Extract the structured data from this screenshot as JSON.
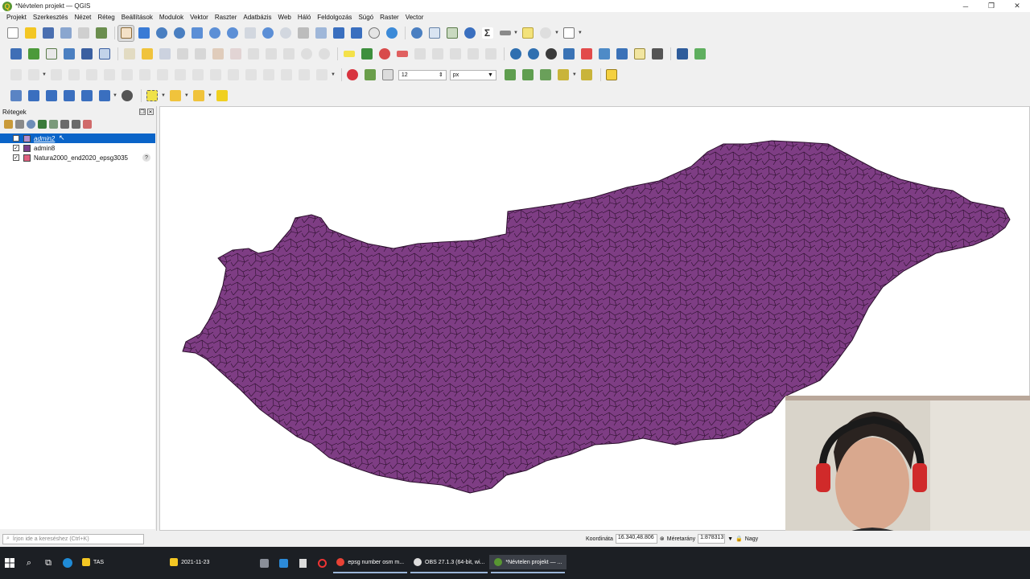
{
  "window": {
    "title": "*Névtelen projekt — QGIS",
    "logo": "Q",
    "minimize": "─",
    "maximize": "❐",
    "close": "✕"
  },
  "menu": [
    "Projekt",
    "Szerkesztés",
    "Nézet",
    "Réteg",
    "Beállítások",
    "Modulok",
    "Vektor",
    "Raszter",
    "Adatbázis",
    "Web",
    "Háló",
    "Feldolgozás",
    "Súgó",
    "Raster",
    "Vector"
  ],
  "toolbar": {
    "snap_tolerance": "12",
    "snap_unit": "px"
  },
  "layers_panel": {
    "title": "Rétegek",
    "layers": [
      {
        "name": "admin2",
        "checked": false,
        "selected": true,
        "color": "#b48fcf"
      },
      {
        "name": "admin8",
        "checked": true,
        "selected": false,
        "color": "#7a3f8a"
      },
      {
        "name": "Natura2000_end2020_epsg3035",
        "checked": true,
        "selected": false,
        "color": "#e0607e"
      }
    ]
  },
  "map": {
    "fill_color": "#7e3d84",
    "stroke_color": "#2b0f2c"
  },
  "status": {
    "search_placeholder": "Írjon ide a kereséshez (Ctrl+K)",
    "coord_label": "Koordináta",
    "coord_value": "16.340,48.806",
    "scale_label": "Méretarány",
    "scale_value": "1:878313",
    "magnifier_label": "Nagy"
  },
  "taskbar": {
    "items": [
      {
        "label": "TAS",
        "color": "#f3c623",
        "open": false,
        "active": false
      },
      {
        "label": "2021-11-23",
        "color": "#f3c623",
        "open": false,
        "active": false
      },
      {
        "label": "epsg number osm m...",
        "color": "#e94235",
        "open": true,
        "active": false
      },
      {
        "label": "OBS 27.1.3 (64-bit, wi...",
        "color": "#dddddd",
        "open": true,
        "active": false
      },
      {
        "label": "*Névtelen projekt — ...",
        "color": "#589632",
        "open": true,
        "active": true
      }
    ]
  }
}
